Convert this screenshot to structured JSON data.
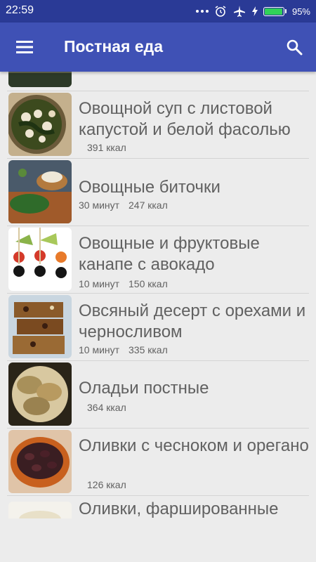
{
  "status": {
    "time": "22:59",
    "battery": "95%",
    "battery_level": 0.95
  },
  "appbar": {
    "title": "Постная еда",
    "menu_icon": "hamburger-icon",
    "search_icon": "search-icon"
  },
  "recipes": [
    {
      "title": "Овощной суп с листовой капустой и белой фасолью",
      "time": "",
      "kcal": "391 ккал"
    },
    {
      "title": "Овощные биточки",
      "time": "30 минут",
      "kcal": "247 ккал"
    },
    {
      "title": "Овощные и фруктовые канапе с авокадо",
      "time": "10 минут",
      "kcal": "150 ккал"
    },
    {
      "title": "Овсяный десерт с орехами и черносливом",
      "time": "10 минут",
      "kcal": "335 ккал"
    },
    {
      "title": "Оладьи постные",
      "time": "",
      "kcal": "364 ккал"
    },
    {
      "title": "Оливки с чесноком и орегано",
      "time": "",
      "kcal": "126 ккал"
    },
    {
      "title": "Оливки, фаршированные",
      "time": "",
      "kcal": ""
    }
  ]
}
